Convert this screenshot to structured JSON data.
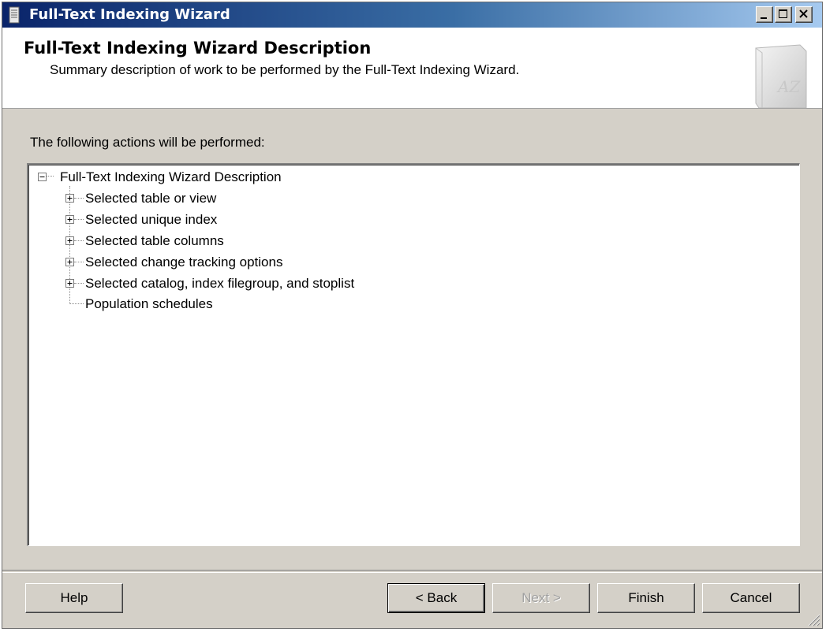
{
  "window": {
    "title": "Full-Text Indexing Wizard",
    "controls": {
      "minimize_icon": "minimize-icon",
      "maximize_icon": "maximize-icon",
      "close_icon": "close-icon"
    }
  },
  "header": {
    "title": "Full-Text Indexing Wizard Description",
    "subtitle": "Summary description of work to be performed by the Full-Text Indexing Wizard.",
    "icon_text": "AZ"
  },
  "body": {
    "actions_label": "The following actions will be performed:",
    "tree": {
      "root": {
        "label": "Full-Text Indexing Wizard Description",
        "expanded": true
      },
      "children": [
        {
          "label": "Selected table or view",
          "expandable": true
        },
        {
          "label": "Selected unique index",
          "expandable": true
        },
        {
          "label": "Selected table columns",
          "expandable": true
        },
        {
          "label": "Selected change tracking options",
          "expandable": true
        },
        {
          "label": "Selected catalog, index filegroup, and stoplist",
          "expandable": true
        },
        {
          "label": "Population schedules",
          "expandable": false
        }
      ]
    }
  },
  "footer": {
    "help": "Help",
    "back": "< Back",
    "next": "Next >",
    "finish": "Finish",
    "cancel": "Cancel"
  },
  "colors": {
    "titlebar_start": "#0a246a",
    "titlebar_end": "#a6caf0",
    "dialog_bg": "#d4d0c8"
  }
}
